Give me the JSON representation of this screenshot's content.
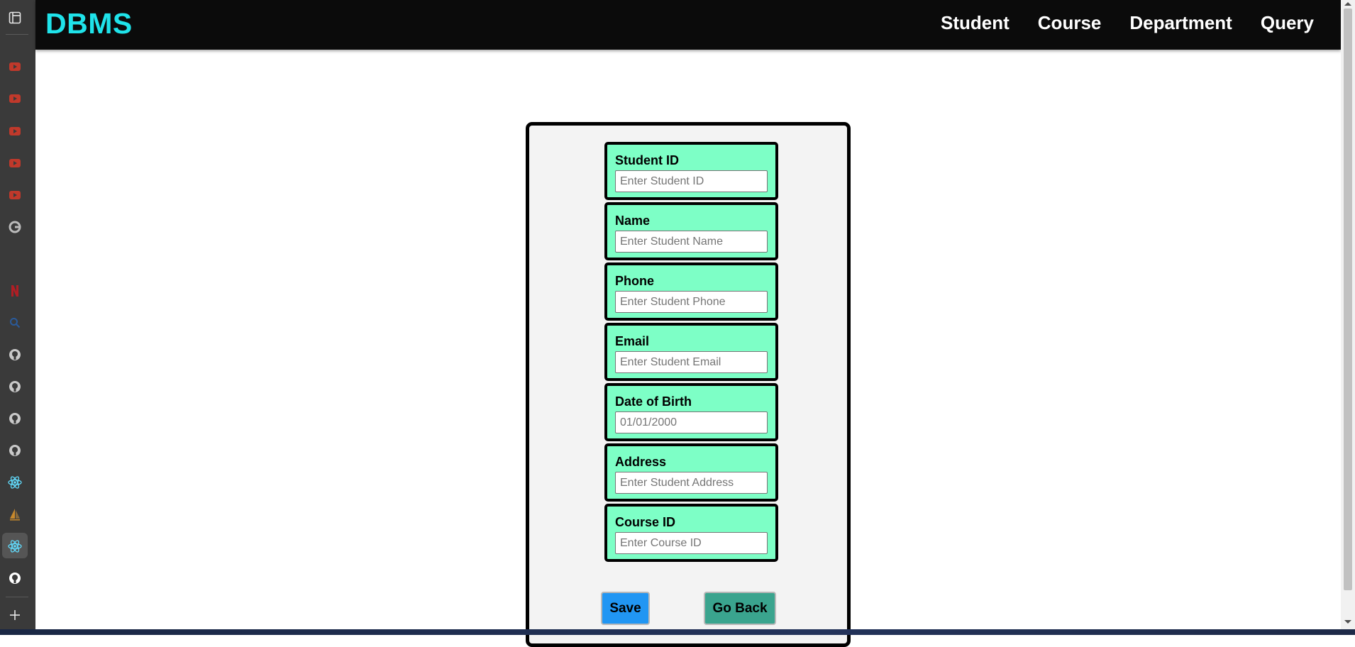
{
  "browser_sidebar": {
    "icons": [
      {
        "name": "workspace-tabs-icon",
        "color": "#e6e6e6"
      },
      {
        "name": "youtube-tab-icon",
        "color": "#c0392b"
      },
      {
        "name": "youtube-tab-icon",
        "color": "#c0392b"
      },
      {
        "name": "youtube-tab-icon",
        "color": "#c0392b"
      },
      {
        "name": "youtube-tab-icon",
        "color": "#c0392b"
      },
      {
        "name": "youtube-tab-icon",
        "color": "#c0392b"
      },
      {
        "name": "google-tab-icon",
        "color": "#bbbbbb"
      },
      {
        "name": "netflix-tab-icon",
        "color": "#b01e24"
      },
      {
        "name": "search-tab-icon",
        "color": "#2a5a9a"
      },
      {
        "name": "github-tab-icon",
        "color": "#c9c9c9"
      },
      {
        "name": "github-tab-icon",
        "color": "#c9c9c9"
      },
      {
        "name": "github-tab-icon",
        "color": "#c9c9c9"
      },
      {
        "name": "github-tab-icon",
        "color": "#c9c9c9"
      },
      {
        "name": "react-tab-icon",
        "color": "#61dafb"
      },
      {
        "name": "sails-tab-icon",
        "color": "#c8892c"
      },
      {
        "name": "react-tab-icon",
        "color": "#61dafb"
      },
      {
        "name": "github-tab-icon",
        "color": "#ffffff"
      },
      {
        "name": "new-tab-icon",
        "color": "#e6e6e6"
      }
    ]
  },
  "navbar": {
    "brand": "DBMS",
    "links": [
      "Student",
      "Course",
      "Department",
      "Query"
    ]
  },
  "form": {
    "fields": [
      {
        "label": "Student ID",
        "placeholder": "Enter Student ID"
      },
      {
        "label": "Name",
        "placeholder": "Enter Student Name"
      },
      {
        "label": "Phone",
        "placeholder": "Enter Student Phone"
      },
      {
        "label": "Email",
        "placeholder": "Enter Student Email"
      },
      {
        "label": "Date of Birth",
        "placeholder": "01/01/2000"
      },
      {
        "label": "Address",
        "placeholder": "Enter Student Address"
      },
      {
        "label": "Course ID",
        "placeholder": "Enter Course ID"
      }
    ],
    "save_label": "Save",
    "back_label": "Go Back"
  },
  "colors": {
    "brand": "#1fe3ea",
    "navbar_bg": "#0b0b0b",
    "field_bg": "#7dffc6",
    "save_button": "#2196f3",
    "back_button": "#3aa48e"
  }
}
